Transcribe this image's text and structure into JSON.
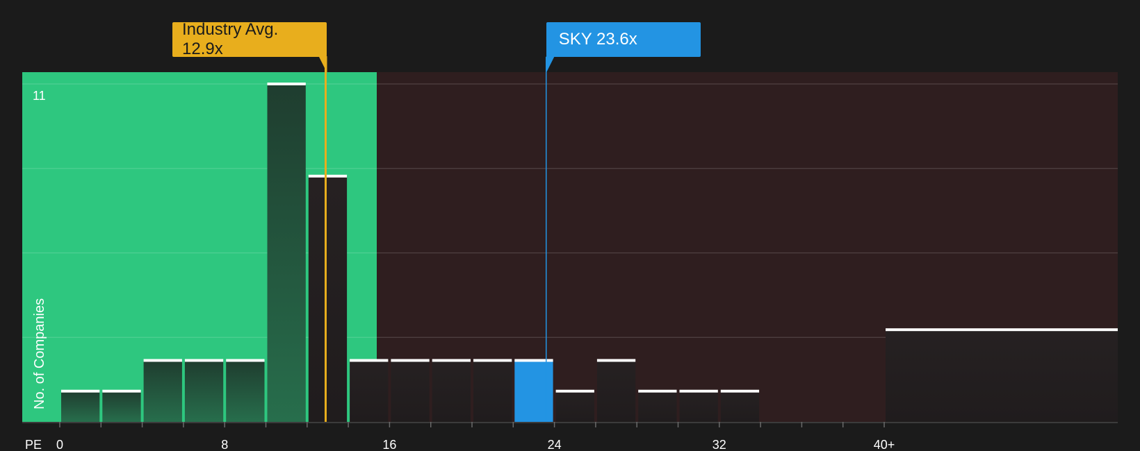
{
  "chart_data": {
    "type": "bar",
    "xlabel": "PE",
    "ylabel": "No. of Companies",
    "x_tick_labels": [
      "0",
      "8",
      "16",
      "24",
      "32",
      "40+"
    ],
    "x_ticks": [
      0,
      8,
      16,
      24,
      32,
      40
    ],
    "y_top_label": "11",
    "ylim": [
      0,
      11
    ],
    "xlim": [
      0,
      40
    ],
    "grid": true,
    "bin_width": 2,
    "bins": [
      {
        "x0": 0,
        "x1": 2,
        "count": 1
      },
      {
        "x0": 2,
        "x1": 4,
        "count": 1
      },
      {
        "x0": 4,
        "x1": 6,
        "count": 2
      },
      {
        "x0": 6,
        "x1": 8,
        "count": 2
      },
      {
        "x0": 8,
        "x1": 10,
        "count": 2
      },
      {
        "x0": 10,
        "x1": 12,
        "count": 11
      },
      {
        "x0": 12,
        "x1": 14,
        "count": 8
      },
      {
        "x0": 14,
        "x1": 16,
        "count": 2
      },
      {
        "x0": 16,
        "x1": 18,
        "count": 2
      },
      {
        "x0": 18,
        "x1": 20,
        "count": 2
      },
      {
        "x0": 20,
        "x1": 22,
        "count": 2
      },
      {
        "x0": 22,
        "x1": 24,
        "count": 2,
        "highlight": true
      },
      {
        "x0": 24,
        "x1": 26,
        "count": 1
      },
      {
        "x0": 26,
        "x1": 28,
        "count": 2
      },
      {
        "x0": 28,
        "x1": 30,
        "count": 1
      },
      {
        "x0": 30,
        "x1": 32,
        "count": 1
      },
      {
        "x0": 32,
        "x1": 34,
        "count": 1
      },
      {
        "x0": 34,
        "x1": 36,
        "count": 0
      },
      {
        "x0": 36,
        "x1": 38,
        "count": 0
      },
      {
        "x0": 38,
        "x1": 40,
        "count": 0
      },
      {
        "x0": 40,
        "x1": 42,
        "count": 3,
        "label": "40+"
      }
    ],
    "industry_avg": {
      "label": "Industry Avg. 12.9x",
      "value": 12.9
    },
    "company": {
      "label": "SKY 23.6x",
      "value": 23.6
    },
    "colors": {
      "background": "#1b1b1b",
      "below_avg_zone": "#2ec77f",
      "above_avg_zone": "#2f1e1f",
      "industry_avg": "#e8ae1d",
      "company": "#2394e3",
      "bar_cap": "#ffffff"
    }
  }
}
